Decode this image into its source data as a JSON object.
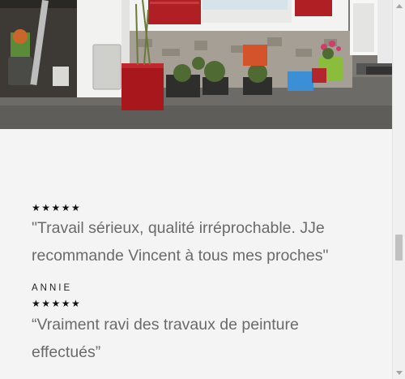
{
  "testimonials": [
    {
      "stars": "★★★★★",
      "rating": 5,
      "quote_line1": "\"Travail sérieux, qualité irréprochable. JJe",
      "quote_line2": "recommande Vincent à tous mes proches\"",
      "author": "ANNIE"
    },
    {
      "stars": "★★★★★",
      "rating": 5,
      "quote_line1": "“Vraiment ravi des travaux de peinture",
      "quote_line2": "effectués”"
    }
  ],
  "colors": {
    "background": "#f4f4f4",
    "quote_text": "#6a6a6a",
    "stars": "#111111",
    "window_shutters": "#b01f24",
    "scrollbar_thumb": "#c1c1c1"
  }
}
